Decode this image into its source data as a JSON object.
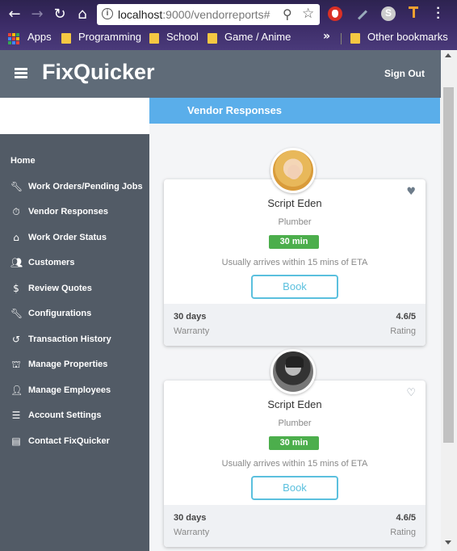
{
  "browser": {
    "url_host": "localhost",
    "url_path": ":9000/vendorreports#",
    "bookmarks": [
      {
        "label": "Apps"
      },
      {
        "label": "Programming"
      },
      {
        "label": "School"
      },
      {
        "label": "Game / Anime"
      },
      {
        "label": "Other bookmarks"
      }
    ],
    "overflow_label": "»"
  },
  "header": {
    "brand": "FixQuicker",
    "signout": "Sign Out"
  },
  "sidebar": {
    "home": "Home",
    "items": [
      {
        "label": "Work Orders/Pending Jobs",
        "icon": "wrench-icon"
      },
      {
        "label": "Vendor Responses",
        "icon": "stopwatch-icon"
      },
      {
        "label": "Work Order Status",
        "icon": "home-icon"
      },
      {
        "label": "Customers",
        "icon": "users-icon"
      },
      {
        "label": "Review Quotes",
        "icon": "dollar-icon"
      },
      {
        "label": "Configurations",
        "icon": "wrench-icon"
      },
      {
        "label": "Transaction History",
        "icon": "history-icon"
      },
      {
        "label": "Manage Properties",
        "icon": "building-icon"
      },
      {
        "label": "Manage Employees",
        "icon": "user-icon"
      },
      {
        "label": "Account Settings",
        "icon": "sliders-icon"
      },
      {
        "label": "Contact FixQuicker",
        "icon": "message-icon"
      }
    ]
  },
  "main": {
    "banner_title": "Vendor Responses",
    "cards": [
      {
        "name": "Script Eden",
        "trade": "Plumber",
        "eta": "30 min",
        "eta_note": "Usually arrives within 15 mins of ETA",
        "book_label": "Book",
        "warranty_value": "30 days",
        "warranty_label": "Warranty",
        "rating_value": "4.6/5",
        "rating_label": "Rating",
        "favorited": true
      },
      {
        "name": "Script Eden",
        "trade": "Plumber",
        "eta": "30 min",
        "eta_note": "Usually arrives within 15 mins of ETA",
        "book_label": "Book",
        "warranty_value": "30 days",
        "warranty_label": "Warranty",
        "rating_value": "4.6/5",
        "rating_label": "Rating",
        "favorited": false
      }
    ]
  },
  "colors": {
    "header_bg": "#5f6b78",
    "sidebar_bg": "#525b66",
    "banner_bg": "#5aaeea",
    "eta_badge": "#4cae4c",
    "book_border": "#5bc0de"
  }
}
